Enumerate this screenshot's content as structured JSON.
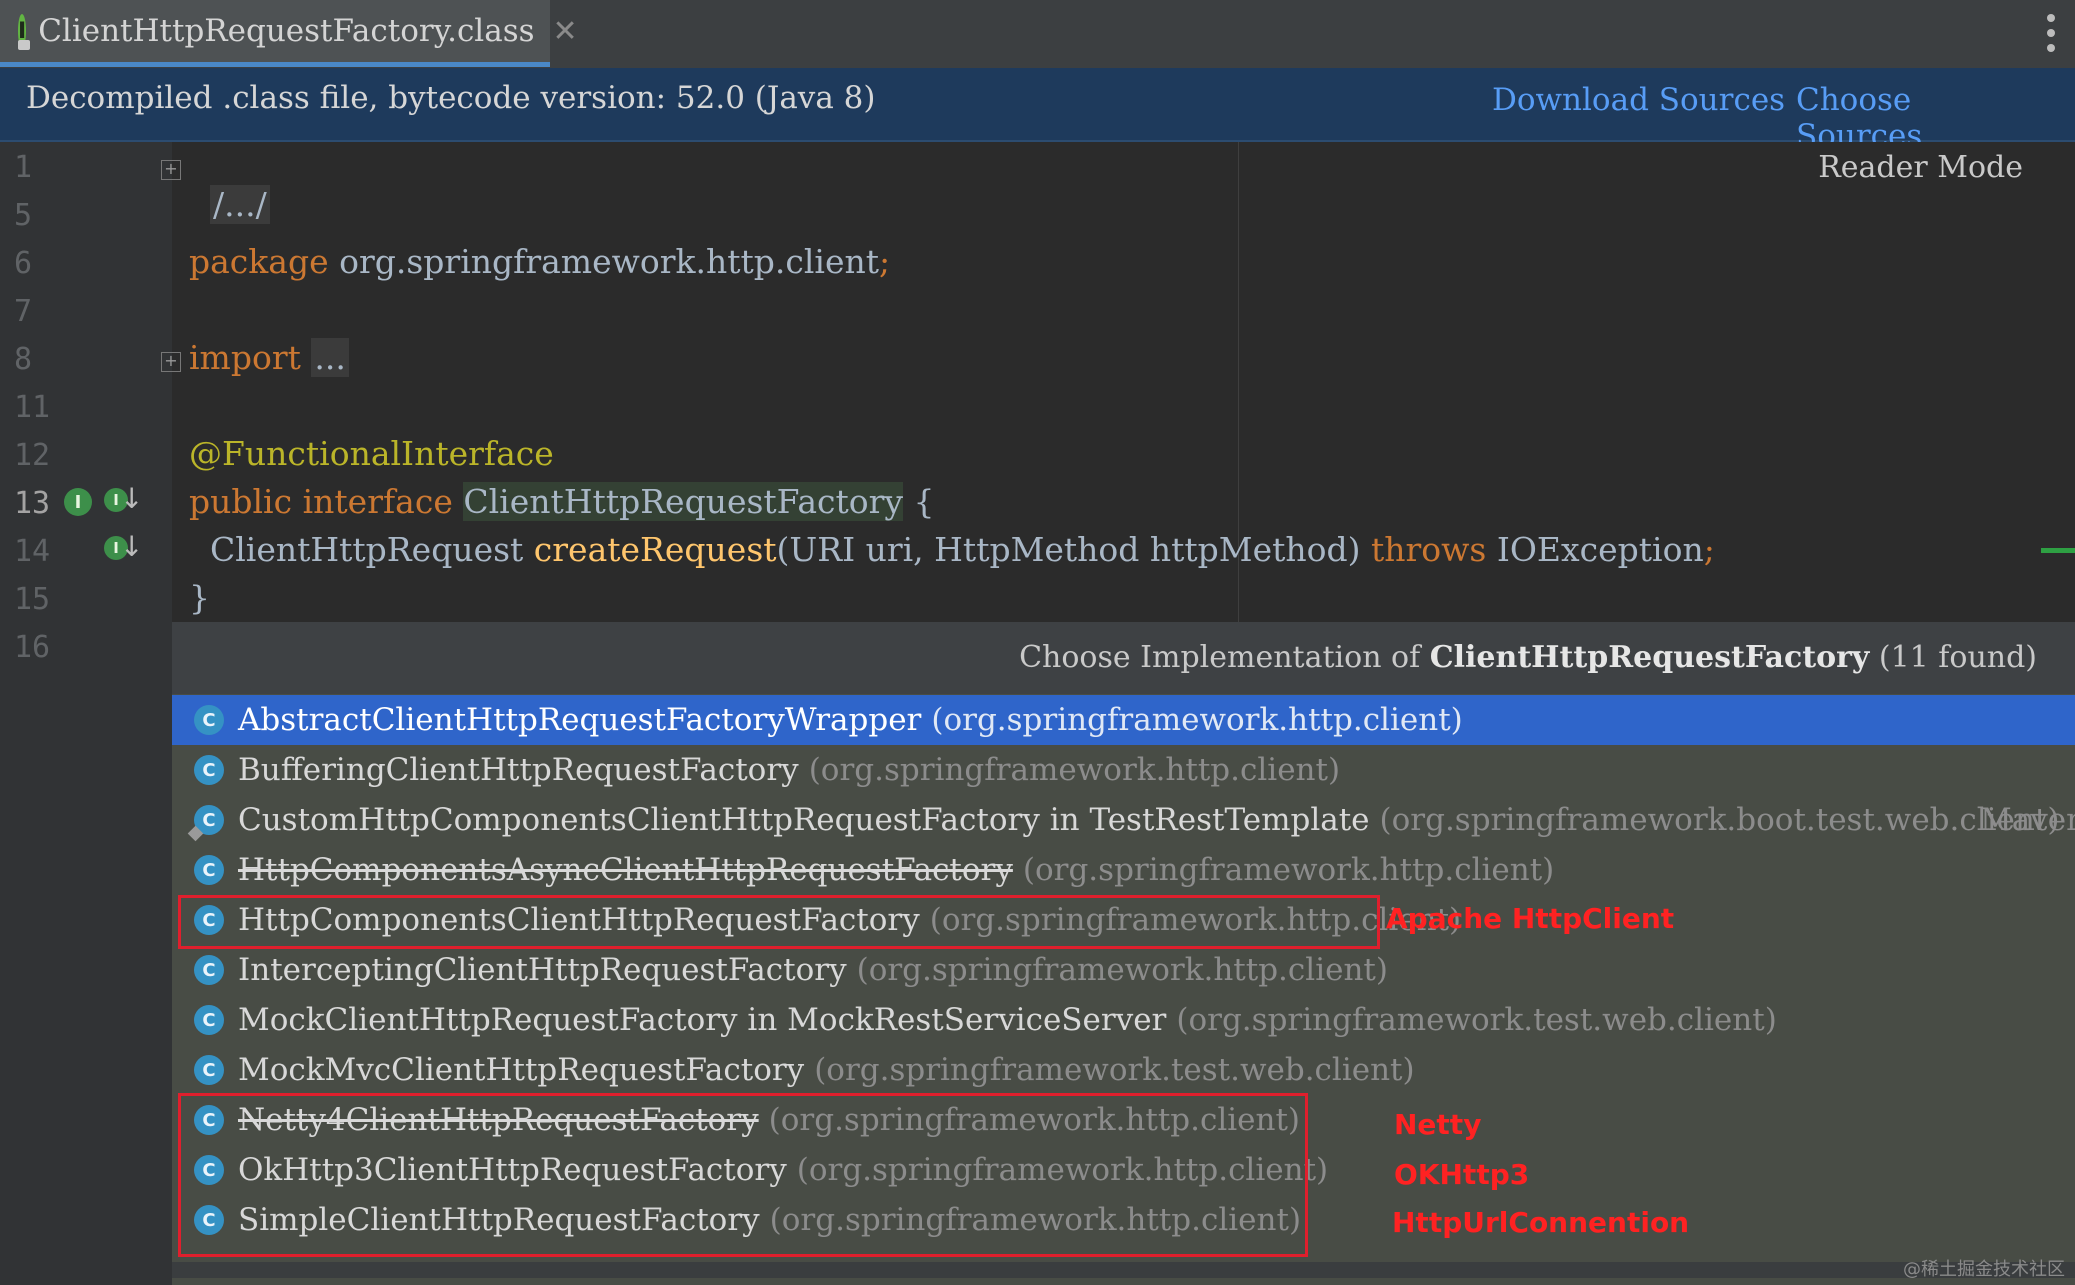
{
  "tab": {
    "title": "ClientHttpRequestFactory.class",
    "close": "✕",
    "icon_letter": "I"
  },
  "banner": {
    "text": "Decompiled .class file, bytecode version: 52.0 (Java 8)",
    "download_sources": "Download Sources",
    "choose_sources": "Choose Sources..."
  },
  "editor": {
    "reader_mode": "Reader Mode",
    "line_numbers": [
      "1",
      "5",
      "6",
      "7",
      "8",
      "11",
      "12",
      "13",
      "14",
      "15",
      "16"
    ],
    "folded_header": "/.../",
    "package_kw": "package",
    "package_name": "org.springframework.http.client",
    "semicolon": ";",
    "import_kw": "import",
    "import_fold": "...",
    "annotation": "@FunctionalInterface",
    "public_kw": "public",
    "interface_kw": "interface",
    "interface_name": "ClientHttpRequestFactory",
    "open_brace": " {",
    "return_type": "ClientHttpRequest",
    "method_name": "createRequest",
    "params": "(URI uri, HttpMethod httpMethod)",
    "throws_kw": "throws",
    "exception": "IOException",
    "close_brace": "}"
  },
  "popup": {
    "title_prefix": "Choose Implementation of ",
    "title_class": "ClientHttpRequestFactory",
    "title_suffix": " (11 found)",
    "maven_label": "Maven",
    "items": [
      {
        "name": "AbstractClientHttpRequestFactoryWrapper",
        "pkg": "(org.springframework.http.client)"
      },
      {
        "name": "BufferingClientHttpRequestFactory",
        "pkg": "(org.springframework.http.client)"
      },
      {
        "name": "CustomHttpComponentsClientHttpRequestFactory in TestRestTemplate",
        "pkg": "(org.springframework.boot.test.web.client)"
      },
      {
        "name": "HttpComponentsAsyncClientHttpRequestFactory",
        "pkg": "(org.springframework.http.client)"
      },
      {
        "name": "HttpComponentsClientHttpRequestFactory",
        "pkg": "(org.springframework.http.client)"
      },
      {
        "name": "InterceptingClientHttpRequestFactory",
        "pkg": "(org.springframework.http.client)"
      },
      {
        "name": "MockClientHttpRequestFactory in MockRestServiceServer",
        "pkg": "(org.springframework.test.web.client)"
      },
      {
        "name": "MockMvcClientHttpRequestFactory",
        "pkg": "(org.springframework.test.web.client)"
      },
      {
        "name": "Netty4ClientHttpRequestFactory",
        "pkg": "(org.springframework.http.client)"
      },
      {
        "name": "OkHttp3ClientHttpRequestFactory",
        "pkg": "(org.springframework.http.client)"
      },
      {
        "name": "SimpleClientHttpRequestFactory",
        "pkg": "(org.springframework.http.client)"
      }
    ],
    "class_icon_letter": "C"
  },
  "annotations": {
    "apache": "Apache HttpClient",
    "netty": "Netty",
    "okhttp": "OKHttp3",
    "httpurl": "HttpUrlConnention"
  },
  "watermark": "@稀土掘金技术社区",
  "colors": {
    "selection": "#2f65ca",
    "keyword": "#cc7832",
    "annotation": "#bbb529",
    "method": "#ffc66d",
    "highlight_red": "#e01f2d",
    "link": "#589df6"
  }
}
